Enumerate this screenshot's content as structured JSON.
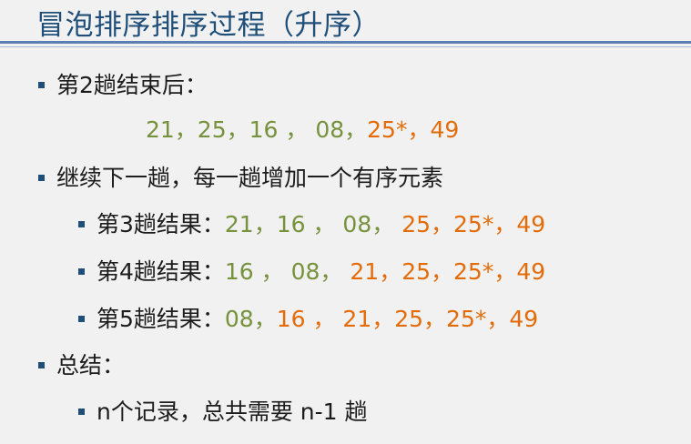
{
  "title": "冒泡排序排序过程（升序）",
  "lines": {
    "pass2_label": "第2趟结束后：",
    "pass2_seq": {
      "a": "21，25，16 ，",
      "b": "08，",
      "c": "25*，",
      "d": "49"
    },
    "continue_label": "继续下一趟，每一趟增加一个有序元素",
    "pass3": {
      "label": "第3趟结果：",
      "green": "21，16 ， 08，",
      "orange": "25，25*，49"
    },
    "pass4": {
      "label": "第4趟结果：",
      "green": "16 ， 08，",
      "orange": "21，25，25*，49"
    },
    "pass5": {
      "label": "第5趟结果：",
      "green": "08，",
      "orange": "16 ， 21，25，25*，49"
    },
    "summary_label": "总结：",
    "summary_item": "n个记录，总共需要 n-1 趟"
  },
  "colors": {
    "title": "#1f4e79",
    "green": "#76923c",
    "orange": "#e36c09",
    "bullet": "#1f4e79"
  }
}
